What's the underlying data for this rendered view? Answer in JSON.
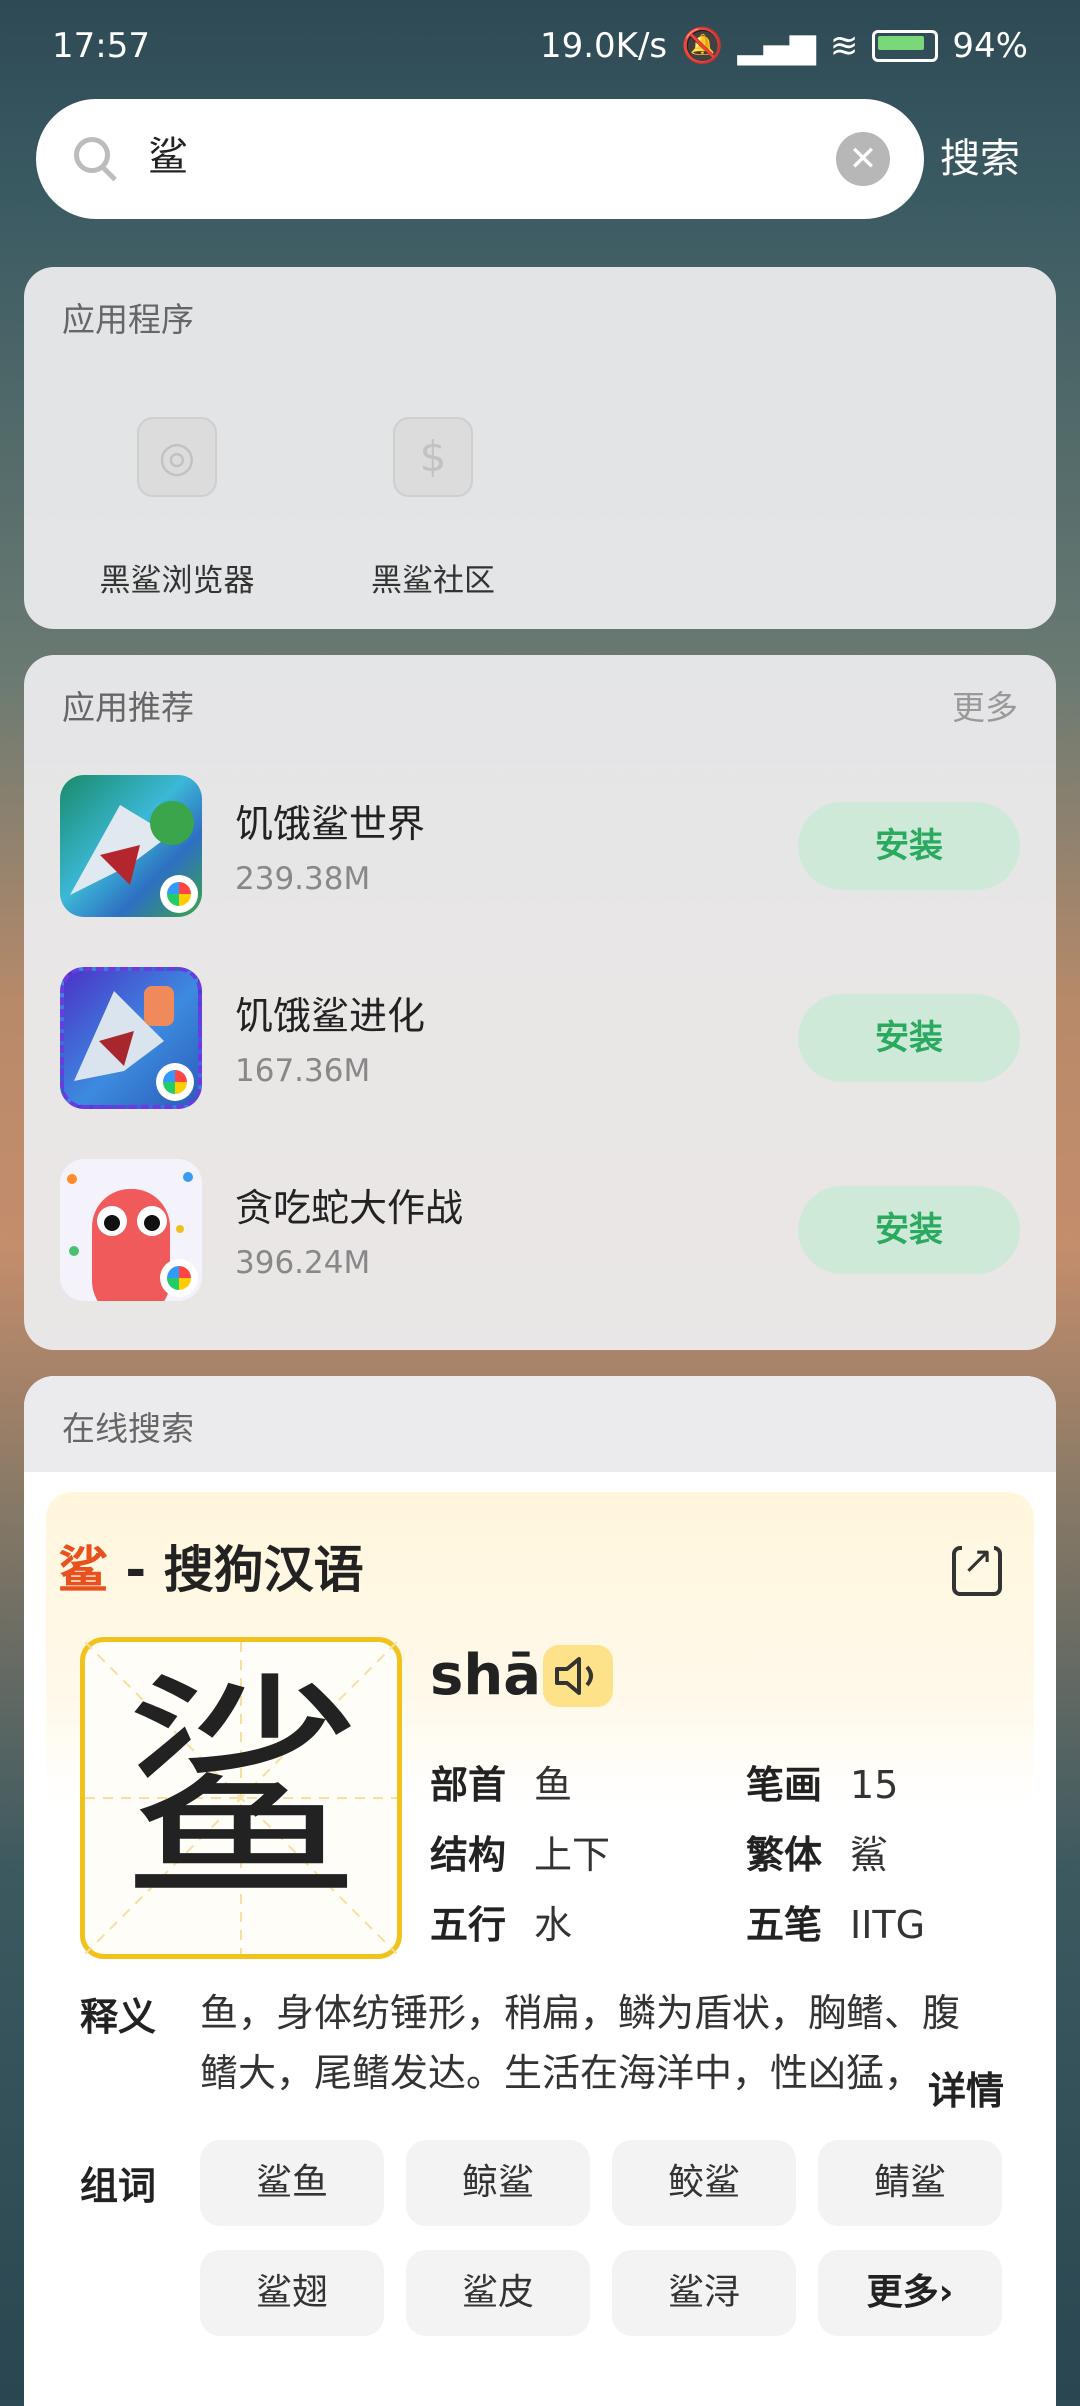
{
  "status_bar": {
    "time": "17:57",
    "net_speed": "19.0K/s",
    "battery": "94%"
  },
  "search": {
    "query": "鲨",
    "button_label": "搜索"
  },
  "apps_section": {
    "title": "应用程序",
    "apps": [
      {
        "label": "黑鲨浏览器",
        "icon": "globe-icon"
      },
      {
        "label": "黑鲨社区",
        "icon": "community-icon"
      }
    ]
  },
  "recommend_section": {
    "title": "应用推荐",
    "more_label": "更多",
    "items": [
      {
        "name": "饥饿鲨世界",
        "size": "239.38M",
        "install_label": "安装"
      },
      {
        "name": "饥饿鲨进化",
        "size": "167.36M",
        "install_label": "安装"
      },
      {
        "name": "贪吃蛇大作战",
        "size": "396.24M",
        "install_label": "安装"
      }
    ]
  },
  "online_section": {
    "title": "在线搜索"
  },
  "dictionary": {
    "char": "鲨",
    "source": " - 搜狗汉语",
    "pinyin": "shā",
    "radical_label": "部首",
    "radical": "鱼",
    "strokes_label": "笔画",
    "strokes": "15",
    "structure_label": "结构",
    "structure": "上下",
    "traditional_label": "繁体",
    "traditional": "鯊",
    "wuxing_label": "五行",
    "wuxing": "水",
    "wubi_label": "五笔",
    "wubi": "IITG",
    "definition_label": "释义",
    "definition": "鱼，身体纺锤形，稍扁，鳞为盾状，胸鳍、腹鳍大，尾鳍发达。生活在海洋中，性凶猛，",
    "detail_label": "详情",
    "words_label": "组词",
    "words": [
      "鲨鱼",
      "鲸鲨",
      "鲛鲨",
      "鲭鲨",
      "鲨翅",
      "鲨皮",
      "鲨浔"
    ],
    "more_words_label": "更多›"
  }
}
